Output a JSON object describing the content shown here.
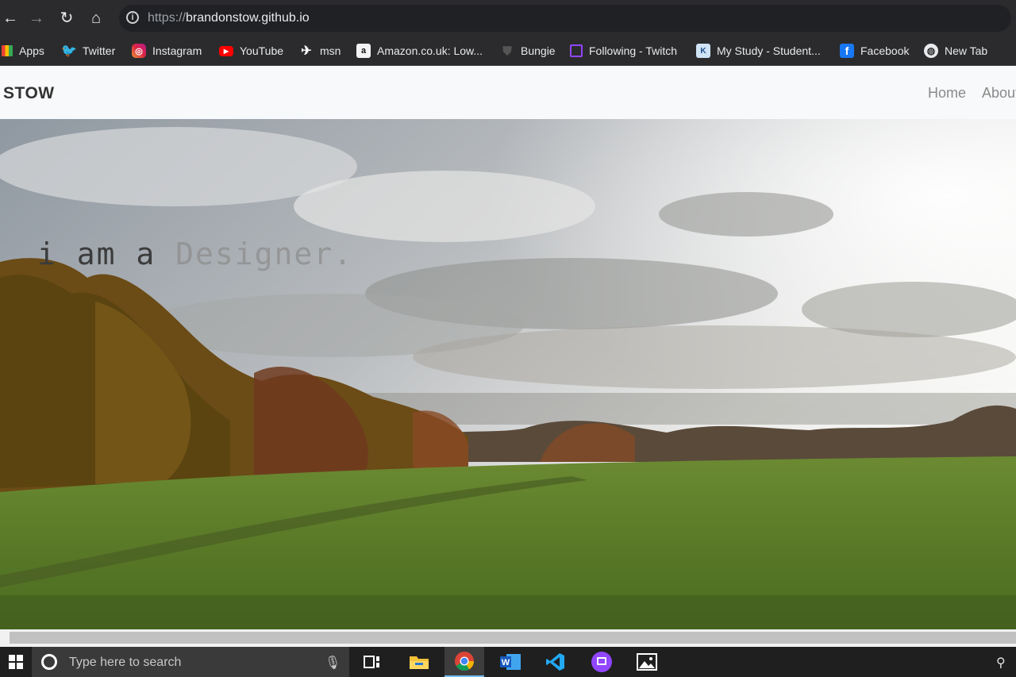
{
  "browser": {
    "url_scheme": "https://",
    "url_host": "brandonstow.github.io",
    "back_glyph": "←",
    "forward_glyph": "→",
    "reload_glyph": "↻",
    "home_glyph": "⌂",
    "info_glyph": "i"
  },
  "bookmarks": [
    {
      "label": "Apps",
      "icon": "apps-grid-icon"
    },
    {
      "label": "Twitter",
      "icon": "twitter-icon",
      "color": "#1da1f2"
    },
    {
      "label": "Instagram",
      "icon": "instagram-icon",
      "color": "#e1306c"
    },
    {
      "label": "YouTube",
      "icon": "youtube-icon",
      "color": "#ff0000"
    },
    {
      "label": "msn",
      "icon": "msn-icon"
    },
    {
      "label": "Amazon.co.uk: Low...",
      "icon": "amazon-icon"
    },
    {
      "label": "Bungie",
      "icon": "bungie-icon"
    },
    {
      "label": "Following - Twitch",
      "icon": "twitch-icon",
      "color": "#9146ff"
    },
    {
      "label": "My Study - Student...",
      "icon": "study-icon"
    },
    {
      "label": "Facebook",
      "icon": "facebook-icon",
      "color": "#1877f2"
    },
    {
      "label": "New Tab",
      "icon": "globe-icon"
    }
  ],
  "site": {
    "brand": "STOW",
    "nav": [
      "Home",
      "About"
    ],
    "hero_text_main": "i am a ",
    "hero_text_faded": "Designer."
  },
  "taskbar": {
    "search_placeholder": "Type here to search",
    "mic_glyph": "🎙",
    "people_glyph": "⚲",
    "apps": [
      "task-view-icon",
      "file-explorer-icon",
      "chrome-icon",
      "word-icon",
      "vscode-icon",
      "twitch-app-icon",
      "photos-icon"
    ]
  }
}
